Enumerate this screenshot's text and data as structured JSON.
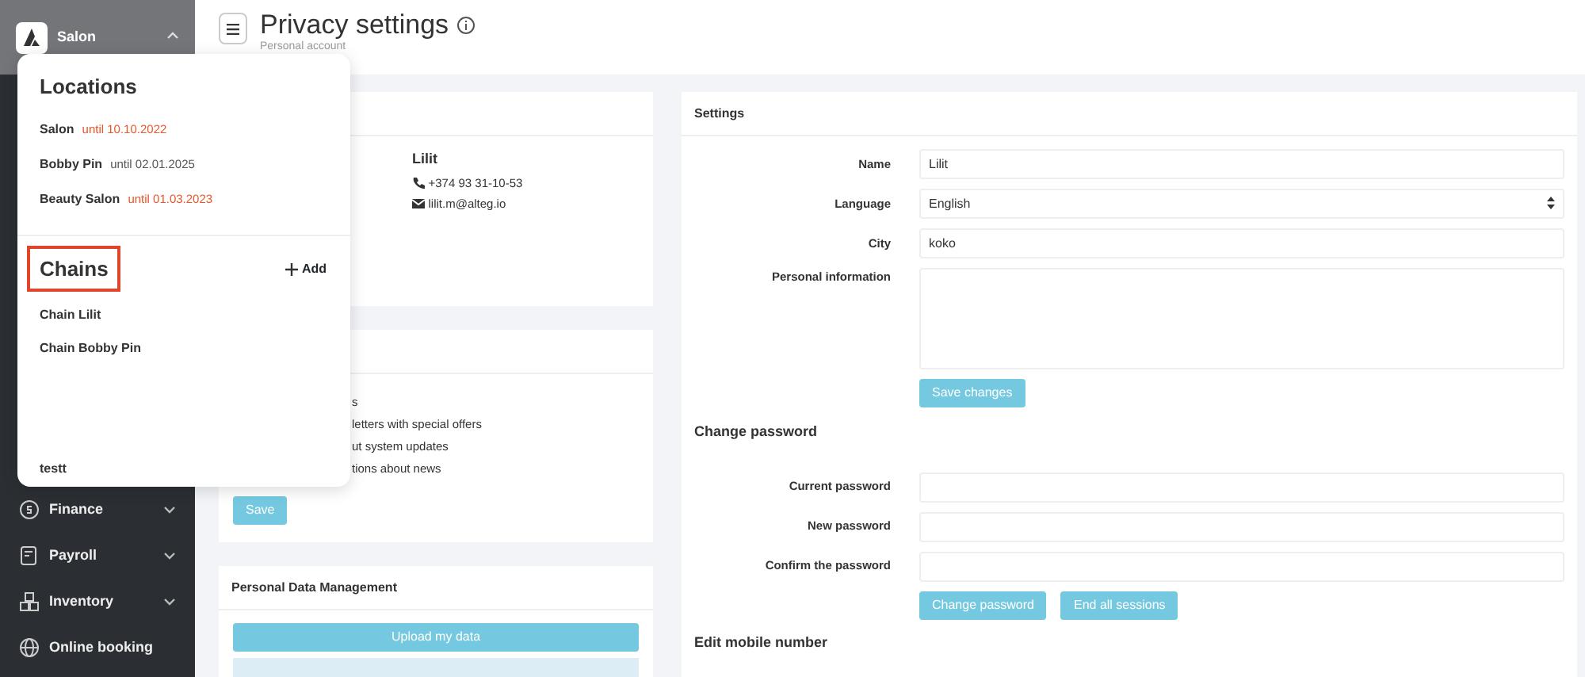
{
  "sidebar": {
    "company": "Salon",
    "expanded": true,
    "items": [
      {
        "label": "Finance",
        "has_submenu": true
      },
      {
        "label": "Payroll",
        "has_submenu": true
      },
      {
        "label": "Inventory",
        "has_submenu": true
      },
      {
        "label": "Online booking",
        "has_submenu": false
      }
    ]
  },
  "header": {
    "title": "Privacy settings",
    "subtitle": "Personal account"
  },
  "dropdown": {
    "locations_title": "Locations",
    "locations": [
      {
        "name": "Salon",
        "until": "until 10.10.2022",
        "expired": true
      },
      {
        "name": "Bobby Pin",
        "until": "until 02.01.2025",
        "expired": false
      },
      {
        "name": "Beauty Salon",
        "until": "until 01.03.2023",
        "expired": true
      }
    ],
    "chains_title": "Chains",
    "add_label": "Add",
    "chains": [
      {
        "name": "Chain Lilit",
        "kind": "item"
      },
      {
        "name": "Chain Bobby Pin",
        "kind": "item"
      },
      {
        "kind": "redacted"
      },
      {
        "name": "testt",
        "kind": "item"
      }
    ]
  },
  "profile": {
    "name": "Lilit",
    "phone": "+374 93 31-10-53",
    "email": "lilit.m@alteg.io"
  },
  "notifications": {
    "items": [
      "s",
      "letters with special offers",
      "ut system updates",
      "tions about news"
    ],
    "save": "Save"
  },
  "data_management": {
    "title": "Personal Data Management",
    "upload": "Upload my data"
  },
  "settings": {
    "title": "Settings",
    "fields": [
      {
        "label": "Name",
        "kind": "input",
        "value": "Lilit"
      },
      {
        "label": "Language",
        "kind": "select",
        "value": "English"
      },
      {
        "label": "City",
        "kind": "input",
        "value": "koko"
      },
      {
        "label": "Personal information",
        "kind": "textarea"
      }
    ],
    "save": "Save changes",
    "password_title": "Change password",
    "password_fields": [
      {
        "label": "Current password"
      },
      {
        "label": "New password"
      },
      {
        "label": "Confirm the password"
      }
    ],
    "buttons": [
      "Change password",
      "End all sessions"
    ],
    "mobile_title": "Edit mobile number"
  }
}
